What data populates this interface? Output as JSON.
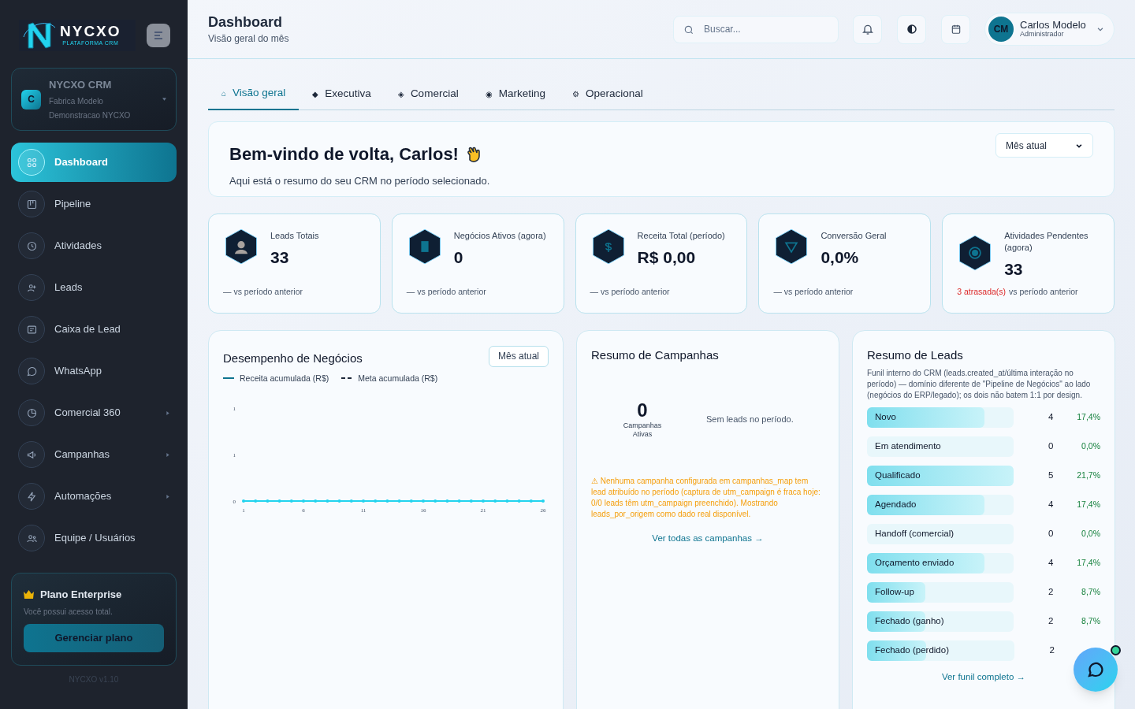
{
  "sidebar": {
    "logo": {
      "name": "NYCXO",
      "tagline": "PLATAFORMA CRM"
    },
    "org": {
      "initial": "C",
      "name": "NYCXO CRM",
      "company": "Fabrica Modelo",
      "subtitle": "Demonstracao NYCXO"
    },
    "items": [
      {
        "label": "Dashboard",
        "selected": true,
        "has_submenu": false
      },
      {
        "label": "Pipeline",
        "selected": false,
        "has_submenu": false
      },
      {
        "label": "Atividades",
        "selected": false,
        "has_submenu": false
      },
      {
        "label": "Leads",
        "selected": false,
        "has_submenu": false
      },
      {
        "label": "Caixa de Lead",
        "selected": false,
        "has_submenu": false
      },
      {
        "label": "WhatsApp",
        "selected": false,
        "has_submenu": false
      },
      {
        "label": "Comercial 360",
        "selected": false,
        "has_submenu": true
      },
      {
        "label": "Campanhas",
        "selected": false,
        "has_submenu": true
      },
      {
        "label": "Automações",
        "selected": false,
        "has_submenu": true
      },
      {
        "label": "Equipe / Usuários",
        "selected": false,
        "has_submenu": false
      }
    ],
    "plan": {
      "title": "Plano Enterprise",
      "text": "Você possui acesso total.",
      "button": "Gerenciar plano"
    },
    "version": "NYCXO v1.10"
  },
  "header": {
    "title": "Dashboard",
    "subtitle": "Visão geral do mês",
    "search": {
      "placeholder": "Buscar..."
    },
    "user": {
      "initials": "CM",
      "name": "Carlos Modelo",
      "role": "Administrador"
    }
  },
  "tabs": [
    {
      "icon": "⌂",
      "label": "Visão geral",
      "selected": true
    },
    {
      "icon": "◆",
      "label": "Executiva",
      "selected": false
    },
    {
      "icon": "◈",
      "label": "Comercial",
      "selected": false
    },
    {
      "icon": "◉",
      "label": "Marketing",
      "selected": false
    },
    {
      "icon": "⚙",
      "label": "Operacional",
      "selected": false
    }
  ],
  "welcome": {
    "title": "Bem-vindo de volta, Carlos!",
    "subtitle": "Aqui está o resumo do seu CRM no período selecionado.",
    "period": "Mês atual"
  },
  "kpis": [
    {
      "label": "Leads Totais",
      "value": "33",
      "note": "— vs período anterior"
    },
    {
      "label": "Negócios Ativos (agora)",
      "value": "0",
      "note": "— vs período anterior"
    },
    {
      "label": "Receita Total (período)",
      "value": "R$ 0,00",
      "note": "— vs período anterior"
    },
    {
      "label": "Conversão Geral",
      "value": "0,0%",
      "note": "— vs período anterior"
    },
    {
      "label": "Atividades Pendentes (agora)",
      "value": "33",
      "alert": "3 atrasada(s)",
      "note": "vs período anterior"
    }
  ],
  "performance": {
    "title": "Desempenho de Negócios",
    "period": "Mês atual",
    "legend": [
      {
        "label": "Meta acumulada (R$)",
        "kind": "dashed"
      }
    ],
    "chart_data": {
      "type": "line",
      "x": [
        1,
        2,
        3,
        4,
        5,
        6,
        7,
        8,
        9,
        10,
        11,
        12,
        13,
        14,
        15,
        16,
        17,
        18,
        19,
        20,
        21,
        22,
        23,
        24,
        25,
        26
      ],
      "series": [
        {
          "name": "Receita acumulada (R$)",
          "color": "#22d3ee",
          "values": [
            0,
            0,
            0,
            0,
            0,
            0,
            0,
            0,
            0,
            0,
            0,
            0,
            0,
            0,
            0,
            0,
            0,
            0,
            0,
            0,
            0,
            0,
            0,
            0,
            0,
            0
          ]
        }
      ],
      "xticks": [
        1,
        6,
        11,
        16,
        21,
        26
      ],
      "xlim": [
        1,
        26
      ],
      "ylim": [
        0,
        1
      ],
      "yticks": [
        0,
        {
          "value": 0.5,
          "label": "1"
        },
        1
      ]
    }
  },
  "campaigns": {
    "title": "Resumo de Campanhas",
    "count": "0",
    "count_label": "Campanhas Ativas",
    "empty": "Sem leads no período.",
    "warning": "⚠ Nenhuma campanha configurada em campanhas_map tem lead atribuído no período (captura de utm_campaign é fraca hoje: 0/0 leads têm utm_campaign preenchido). Mostrando leads_por_origem como dado real disponível.",
    "link": "Ver todas as campanhas →"
  },
  "leads": {
    "title": "Resumo de Leads",
    "description": "Funil interno do CRM (leads.created_at/última interação no período) — domínio diferente de \"Pipeline de Negócios\" ao lado (negócios do ERP/legado); os dois não batem 1:1 por design.",
    "stages": [
      {
        "label": "Novo",
        "count": "4",
        "percent": "17,4%",
        "level": 0.8
      },
      {
        "label": "Em atendimento",
        "count": "0",
        "percent": "0,0%",
        "level": 0
      },
      {
        "label": "Qualificado",
        "count": "5",
        "percent": "21,7%",
        "level": 1
      },
      {
        "label": "Agendado",
        "count": "4",
        "percent": "17,4%",
        "level": 0.8
      },
      {
        "label": "Handoff (comercial)",
        "count": "0",
        "percent": "0,0%",
        "level": 0
      },
      {
        "label": "Orçamento enviado",
        "count": "4",
        "percent": "17,4%",
        "level": 0.8
      },
      {
        "label": "Follow-up",
        "count": "2",
        "percent": "8,7%",
        "level": 0.4
      },
      {
        "label": "Fechado (ganho)",
        "count": "2",
        "percent": "8,7%",
        "level": 0.4
      },
      {
        "label": "Fechado (perdido)",
        "count": "2",
        "level": 0.4
      }
    ],
    "link": "Ver funil completo →"
  }
}
